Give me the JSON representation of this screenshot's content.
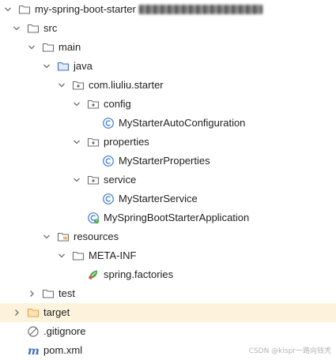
{
  "tree": {
    "root": {
      "label": "my-spring-boot-starter",
      "suffix": "[my-spring-boot-starter]"
    },
    "src": "src",
    "main": "main",
    "java": "java",
    "package": "com.liuliu.starter",
    "config": "config",
    "config_class": "MyStarterAutoConfiguration",
    "properties": "properties",
    "properties_class": "MyStarterProperties",
    "service": "service",
    "service_class": "MyStarterService",
    "app_class": "MySpringBootStarterApplication",
    "resources": "resources",
    "meta_inf": "META-INF",
    "factories": "spring.factories",
    "test": "test",
    "target": "target",
    "gitignore": ".gitignore",
    "pom": "pom.xml"
  },
  "watermark": "CSDN @kispr一路向钱秃",
  "colors": {
    "class_icon": "#3d7cd6",
    "folder_stroke": "#6e6e6e",
    "target_folder": "#e0a443",
    "spring_green": "#4fa84a",
    "highlight_row": "#fdf3dc",
    "maven_blue": "#3c6dc5"
  },
  "icons": {
    "arrow_expanded": "chevron-down-icon",
    "arrow_collapsed": "chevron-right-icon",
    "folder": "folder-icon",
    "source_folder": "source-folder-icon",
    "package": "package-icon",
    "class": "class-icon",
    "spring_app": "spring-boot-class-icon",
    "resources": "resources-folder-icon",
    "factories": "spring-factories-icon",
    "gitignore": "ignore-file-icon",
    "maven": "maven-icon"
  }
}
